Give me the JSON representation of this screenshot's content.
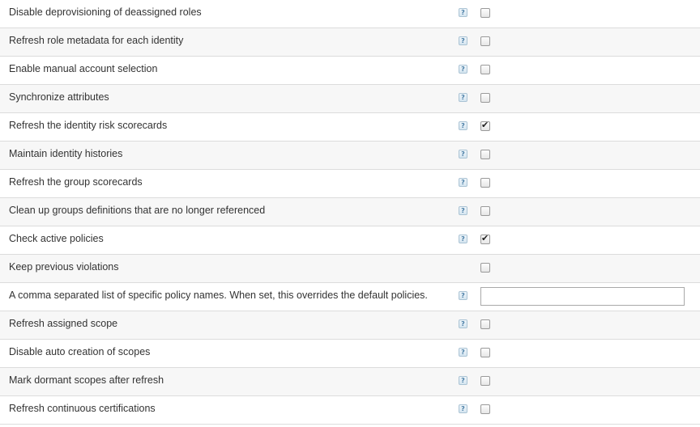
{
  "options": [
    {
      "label": "Disable deprovisioning of deassigned roles",
      "type": "checkbox",
      "checked": false,
      "help": true
    },
    {
      "label": "Refresh role metadata for each identity",
      "type": "checkbox",
      "checked": false,
      "help": true
    },
    {
      "label": "Enable manual account selection",
      "type": "checkbox",
      "checked": false,
      "help": true
    },
    {
      "label": "Synchronize attributes",
      "type": "checkbox",
      "checked": false,
      "help": true
    },
    {
      "label": "Refresh the identity risk scorecards",
      "type": "checkbox",
      "checked": true,
      "help": true
    },
    {
      "label": "Maintain identity histories",
      "type": "checkbox",
      "checked": false,
      "help": true
    },
    {
      "label": "Refresh the group scorecards",
      "type": "checkbox",
      "checked": false,
      "help": true
    },
    {
      "label": "Clean up groups definitions that are no longer referenced",
      "type": "checkbox",
      "checked": false,
      "help": true
    },
    {
      "label": "Check active policies",
      "type": "checkbox",
      "checked": true,
      "help": true
    },
    {
      "label": "Keep previous violations",
      "type": "checkbox",
      "checked": false,
      "help": false
    },
    {
      "label": "A comma separated list of specific policy names. When set, this overrides the default policies.",
      "type": "text",
      "value": "",
      "help": true
    },
    {
      "label": "Refresh assigned scope",
      "type": "checkbox",
      "checked": false,
      "help": true
    },
    {
      "label": "Disable auto creation of scopes",
      "type": "checkbox",
      "checked": false,
      "help": true
    },
    {
      "label": "Mark dormant scopes after refresh",
      "type": "checkbox",
      "checked": false,
      "help": true
    },
    {
      "label": "Refresh continuous certifications",
      "type": "checkbox",
      "checked": false,
      "help": true
    }
  ],
  "help_icon_glyph": "?",
  "check_glyph": "✔",
  "colors": {
    "row_alt_bg": "#f7f7f7",
    "row_border": "#dcdcdc",
    "label_text": "#333333",
    "help_icon_fg": "#4a7ea6"
  }
}
